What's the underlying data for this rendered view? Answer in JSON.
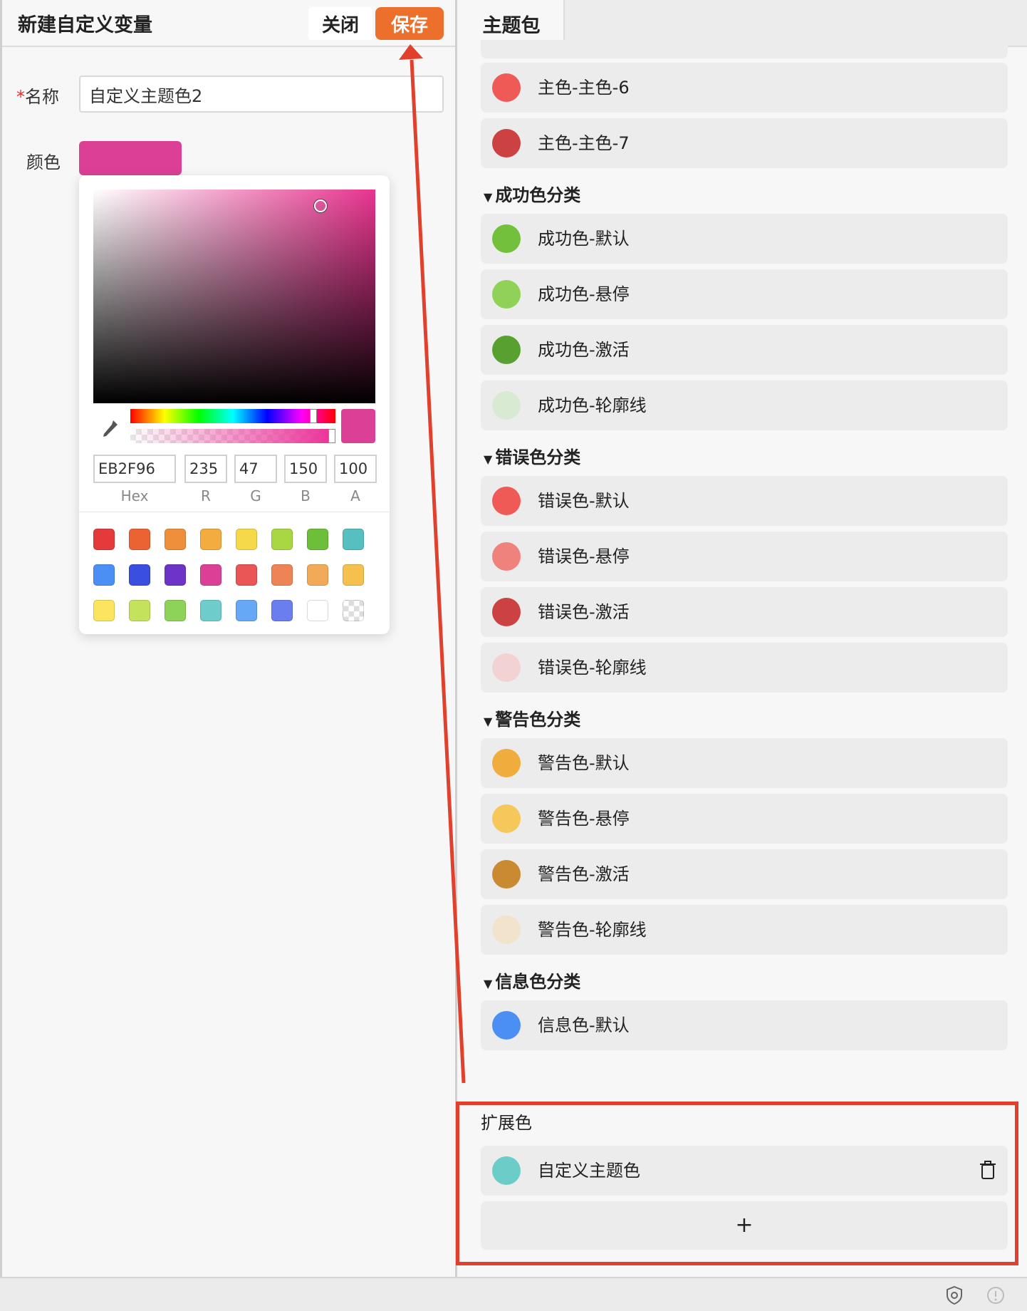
{
  "left": {
    "title": "新建自定义变量",
    "close_label": "关闭",
    "save_label": "保存",
    "name_required_mark": "*",
    "name_label": "名称",
    "name_value": "自定义主题色2",
    "color_label": "颜色",
    "color_value": "#dc3f96"
  },
  "picker": {
    "hex": "EB2F96",
    "r": "235",
    "g": "47",
    "b": "150",
    "a": "100",
    "labels": {
      "hex": "Hex",
      "r": "R",
      "g": "G",
      "b": "B",
      "a": "A"
    },
    "presets": [
      [
        "#e53a3a",
        "#eb6233",
        "#ef8e3b",
        "#f2ac40",
        "#f6d94a",
        "#a9d643",
        "#6dbf3a",
        "#56bfbf"
      ],
      [
        "#4b8ff5",
        "#3a4ee0",
        "#6d35c7",
        "#dc3f96",
        "#ea5555",
        "#ee8355",
        "#f3aa58",
        "#f5c04e"
      ],
      [
        "#fbe55e",
        "#c4e25c",
        "#8cd358",
        "#6ecdcb",
        "#66a8f6",
        "#6b7ef0",
        "#ffffff",
        "checker"
      ]
    ]
  },
  "right": {
    "tab_label": "主题包",
    "groups": [
      {
        "title": "",
        "items": [
          {
            "label": "主色-主色-6",
            "color": "#ef5a57"
          },
          {
            "label": "主色-主色-7",
            "color": "#cc4142"
          }
        ]
      },
      {
        "title": "成功色分类",
        "items": [
          {
            "label": "成功色-默认",
            "color": "#72c03c"
          },
          {
            "label": "成功色-悬停",
            "color": "#8fd257"
          },
          {
            "label": "成功色-激活",
            "color": "#58a030"
          },
          {
            "label": "成功色-轮廓线",
            "color": "#d9ead2"
          }
        ]
      },
      {
        "title": "错误色分类",
        "items": [
          {
            "label": "错误色-默认",
            "color": "#ef5a57"
          },
          {
            "label": "错误色-悬停",
            "color": "#f0827e"
          },
          {
            "label": "错误色-激活",
            "color": "#cc4142"
          },
          {
            "label": "错误色-轮廓线",
            "color": "#f2d2d3"
          }
        ]
      },
      {
        "title": "警告色分类",
        "items": [
          {
            "label": "警告色-默认",
            "color": "#f0ac3c"
          },
          {
            "label": "警告色-悬停",
            "color": "#f6c75a"
          },
          {
            "label": "警告色-激活",
            "color": "#c98a31"
          },
          {
            "label": "警告色-轮廓线",
            "color": "#f1e3cc"
          }
        ]
      },
      {
        "title": "信息色分类",
        "items": [
          {
            "label": "信息色-默认",
            "color": "#4b8ff5"
          }
        ]
      }
    ],
    "extension_title": "扩展色",
    "extension_items": [
      {
        "label": "自定义主题色",
        "color": "#6ccdc8"
      }
    ],
    "add_label": "+"
  },
  "accent_colors": {
    "save": "#ec6f2b",
    "annotation": "#e0402c"
  }
}
